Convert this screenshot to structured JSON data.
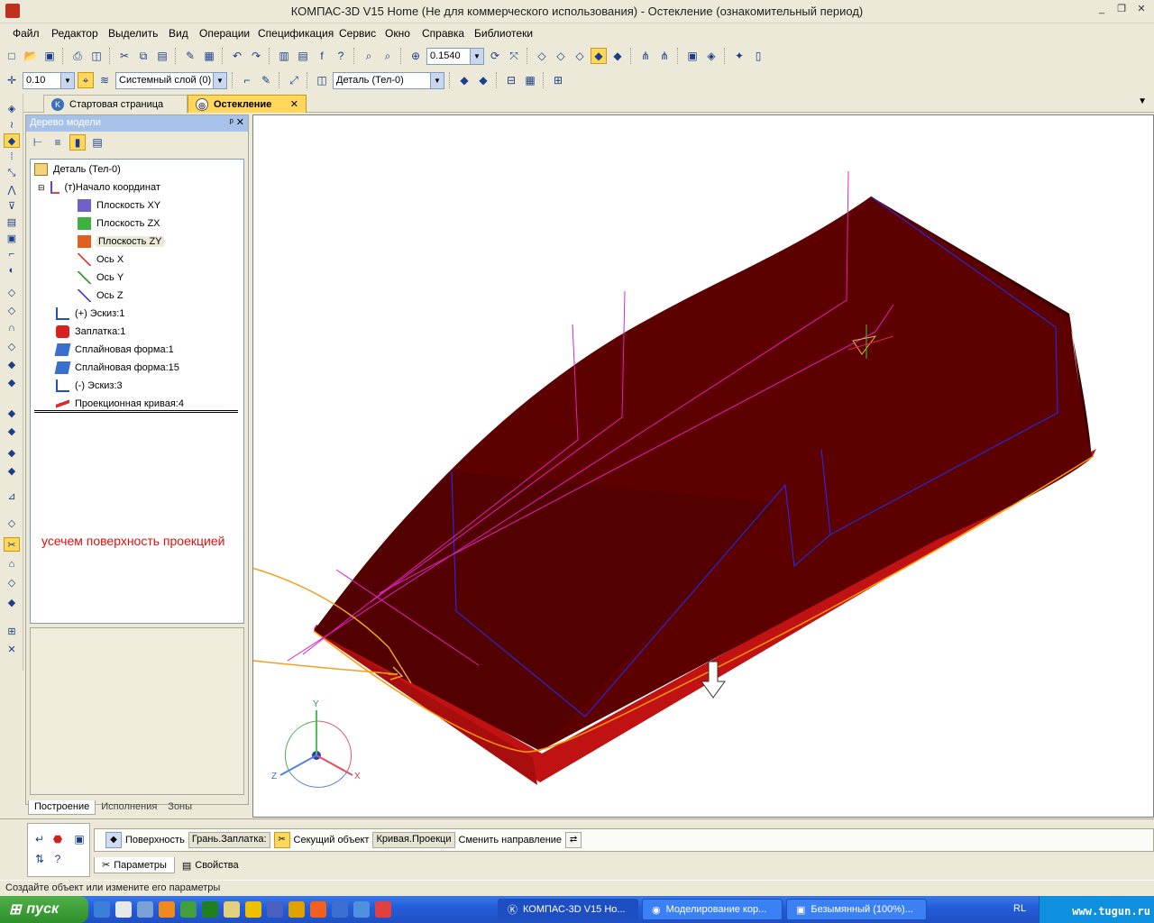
{
  "window": {
    "title": "КОМПАС-3D V15 Home (Не для коммерческого использования) - Остекление (ознакомительный период)"
  },
  "menu": [
    "Файл",
    "Редактор",
    "Выделить",
    "Вид",
    "Операции",
    "Спецификация",
    "Сервис",
    "Окно",
    "Справка",
    "Библиотеки"
  ],
  "toolbar1": {
    "zoom_value": "0.1540"
  },
  "toolbar2": {
    "step_value": "0.10",
    "layer_value": "Системный слой (0)",
    "part_value": "Деталь (Тел-0)"
  },
  "tabs": [
    {
      "label": "Стартовая страница"
    },
    {
      "label": "Остекление",
      "close": "✕"
    }
  ],
  "tree_panel": {
    "title": "Дерево модели",
    "controls": "ᵖ ✕",
    "nodes": [
      {
        "label": "Деталь (Тел-0)"
      },
      {
        "label": "(т)Начало координат"
      },
      {
        "label": "Плоскость XY"
      },
      {
        "label": "Плоскость ZX"
      },
      {
        "label": "Плоскость ZY"
      },
      {
        "label": "Ось X"
      },
      {
        "label": "Ось Y"
      },
      {
        "label": "Ось Z"
      },
      {
        "label": "(+) Эскиз:1"
      },
      {
        "label": "Заплатка:1"
      },
      {
        "label": "Сплайновая форма:1"
      },
      {
        "label": "Сплайновая форма:15"
      },
      {
        "label": "(-) Эскиз:3"
      },
      {
        "label": "Проекционная кривая:4"
      }
    ],
    "bottom_tabs": [
      "Построение",
      "Исполнения",
      "Зоны"
    ]
  },
  "annotation": {
    "text": "усечем поверхность проекцией",
    "color": "#e01010"
  },
  "triad": {
    "x": "X",
    "y": "Y",
    "z": "Z"
  },
  "props": {
    "surface_label": "Поверхность",
    "surface_value": "Грань.Заплатка:",
    "cutter_label": "Секущий объект",
    "cutter_value": "Кривая.Проекци",
    "direction_label": "Сменить направление",
    "tabs": [
      "Параметры",
      "Свойства"
    ]
  },
  "status": "Создайте объект или измените его параметры",
  "taskbar": {
    "start": "пуск",
    "tasks": [
      "КОМПАС-3D V15 Ho...",
      "Моделирование кор...",
      "Безымянный (100%)..."
    ],
    "lang": "RL",
    "watermark": "www.tugun.ru"
  },
  "colors": {
    "body": "#5c0000",
    "body_side": "#c01010",
    "edge": "#ff9a00",
    "sketch": "#2828d8",
    "curve": "#e020c8",
    "accent": "#ffd75a"
  }
}
